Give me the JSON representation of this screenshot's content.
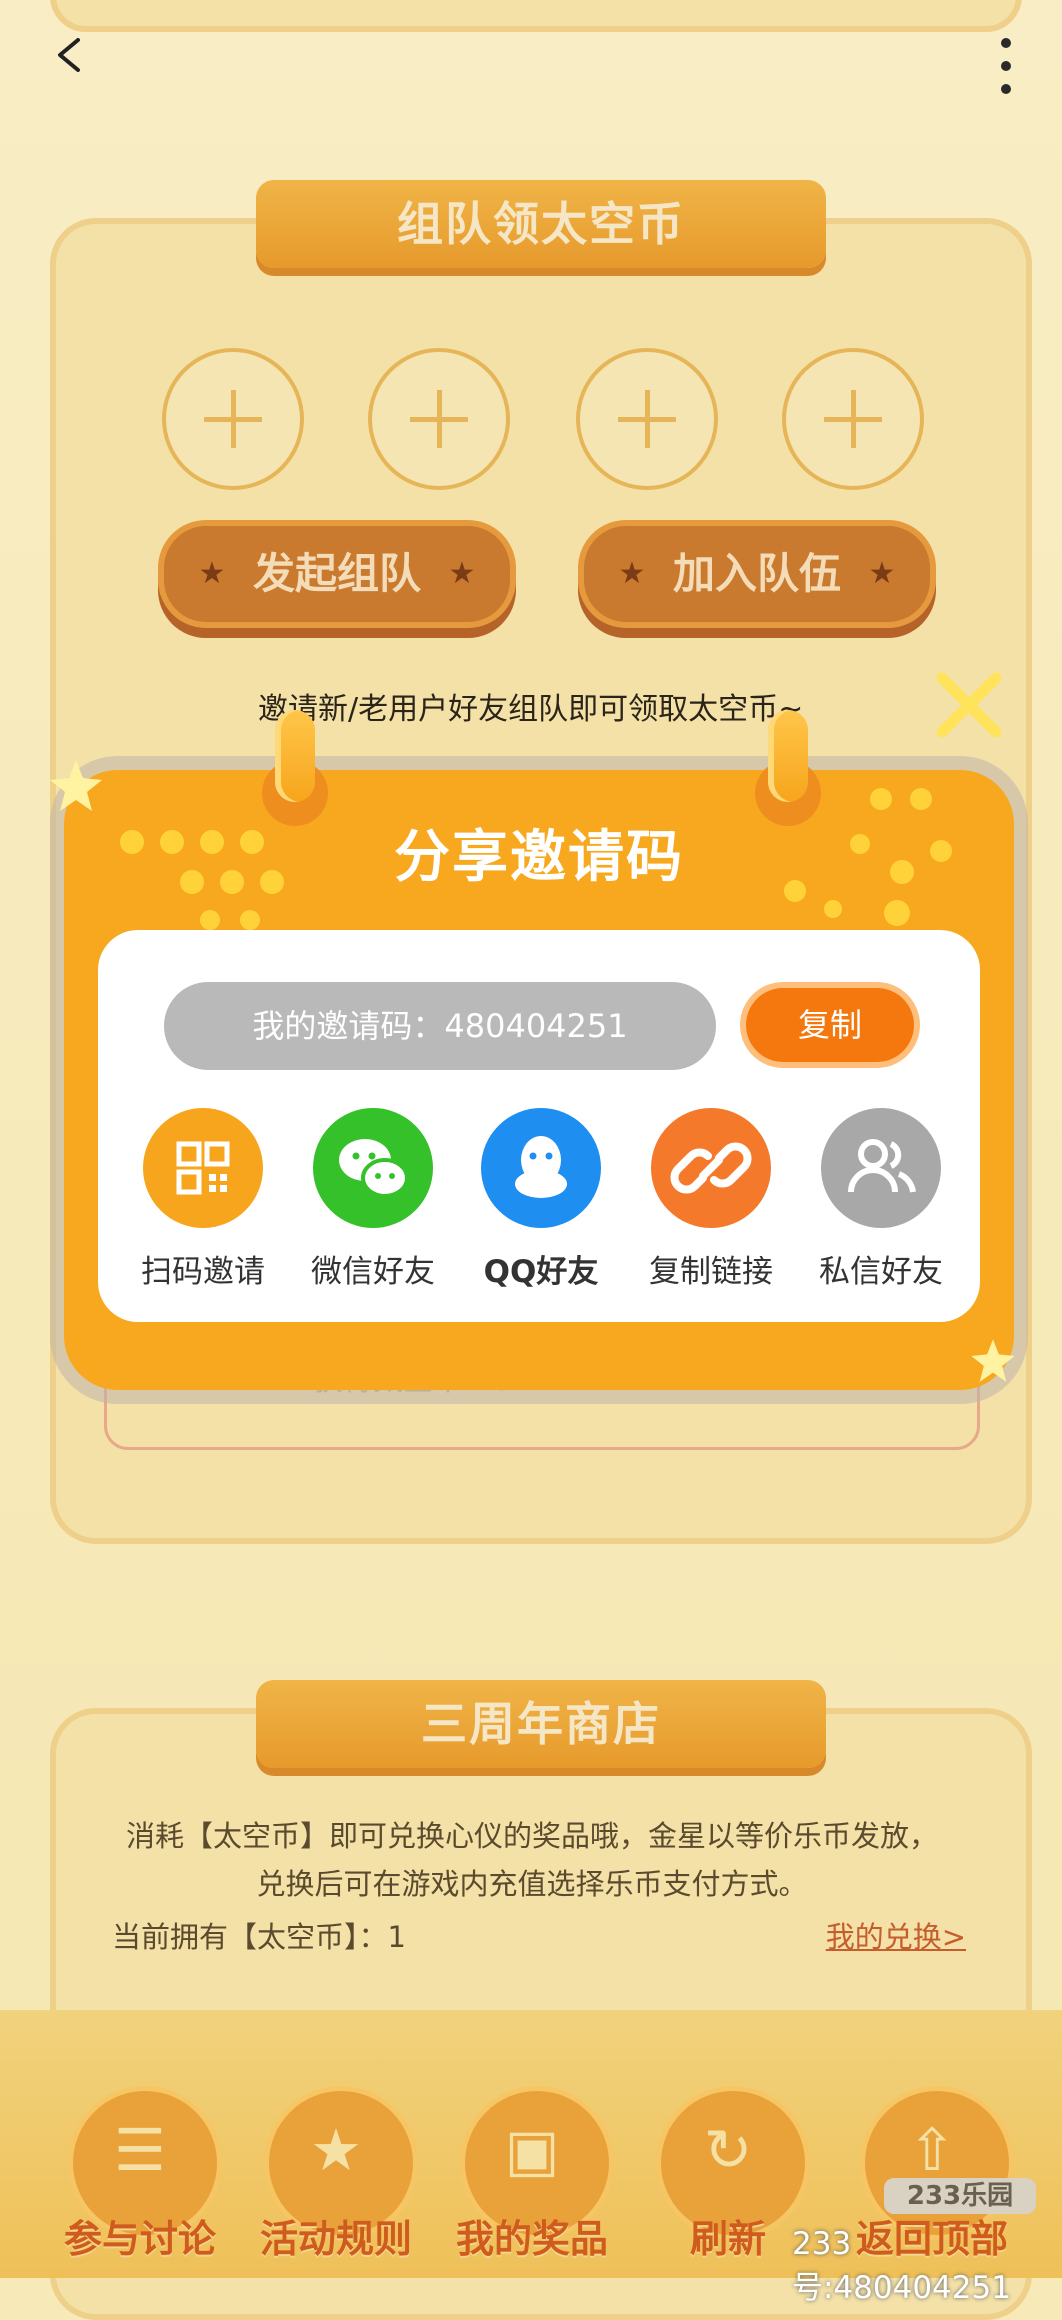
{
  "team_section": {
    "title": "组队领太空币",
    "start_team_label": "发起组队",
    "join_team_label": "加入队伍",
    "invite_hint": "邀请新/老用户好友组队即可领取太空币~",
    "reward_text": "获得太空币 10"
  },
  "invite_modal": {
    "title": "分享邀请码",
    "invite_code_label": "我的邀请码：480404251",
    "copy_label": "复制",
    "share_options": [
      {
        "label": "扫码邀请",
        "icon": "qr-code-icon",
        "color": "#f7a51c"
      },
      {
        "label": "微信好友",
        "icon": "wechat-icon",
        "color": "#35c12a"
      },
      {
        "label": "QQ好友",
        "icon": "qq-icon",
        "color": "#1f8ef1"
      },
      {
        "label": "复制链接",
        "icon": "link-icon",
        "color": "#f4792a"
      },
      {
        "label": "私信好友",
        "icon": "users-icon",
        "color": "#a8a8a8"
      }
    ]
  },
  "shop_section": {
    "title": "三周年商店",
    "description_line1": "消耗【太空币】即可兑换心仪的奖品哦，金星以等价乐币发放，",
    "description_line2": "兑换后可在游戏内充值选择乐币支付方式。",
    "balance_label": "当前拥有【太空币】：1",
    "my_exchange_link": "我的兑换>"
  },
  "bottom_nav": [
    {
      "label": "参与讨论",
      "icon": "chat-icon"
    },
    {
      "label": "活动规则",
      "icon": "star-icon"
    },
    {
      "label": "我的奖品",
      "icon": "gift-icon"
    },
    {
      "label": "刷新",
      "icon": "refresh-icon"
    },
    {
      "label": "返回顶部",
      "icon": "arrow-up-icon"
    }
  ],
  "watermark": {
    "logo": "233乐园",
    "text": "233号:480404251"
  },
  "colors": {
    "modal_orange": "#f7a81f",
    "copy_button": "#f5780f",
    "overlay_tint": "#f6e7b1"
  }
}
